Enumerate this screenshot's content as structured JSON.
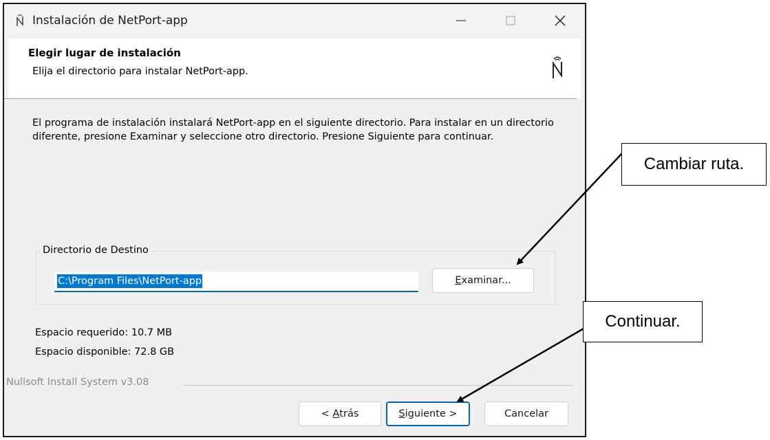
{
  "window": {
    "title": "Instalación de NetPort-app",
    "minimize_icon": "minimize-icon",
    "maximize_icon": "maximize-icon",
    "close_icon": "close-icon"
  },
  "header": {
    "title": "Elegir lugar de instalación",
    "subtitle": "Elija el directorio para instalar NetPort-app."
  },
  "body": {
    "description": "El programa de instalación instalará NetPort-app en el siguiente directorio. Para instalar en un directorio diferente, presione Examinar y seleccione otro directorio. Presione Siguiente para continuar."
  },
  "destination": {
    "group_label": "Directorio de Destino",
    "path_value": "C:\\Program Files\\NetPort-app",
    "browse_key": "E",
    "browse_rest": "xaminar..."
  },
  "space": {
    "required": "Espacio requerido: 10.7 MB",
    "available": "Espacio disponible: 72.8 GB"
  },
  "footer": {
    "brand": "Nullsoft Install System v3.08",
    "back_prefix": "< ",
    "back_key": "A",
    "back_rest": "trás",
    "next_key": "S",
    "next_rest": "iguiente >",
    "cancel_label": "Cancelar"
  },
  "annotations": {
    "change_path": "Cambiar ruta.",
    "continue": "Continuar."
  },
  "colors": {
    "accent": "#0067c0",
    "selection": "#0078d4",
    "window_bg": "#f0f0f0"
  }
}
